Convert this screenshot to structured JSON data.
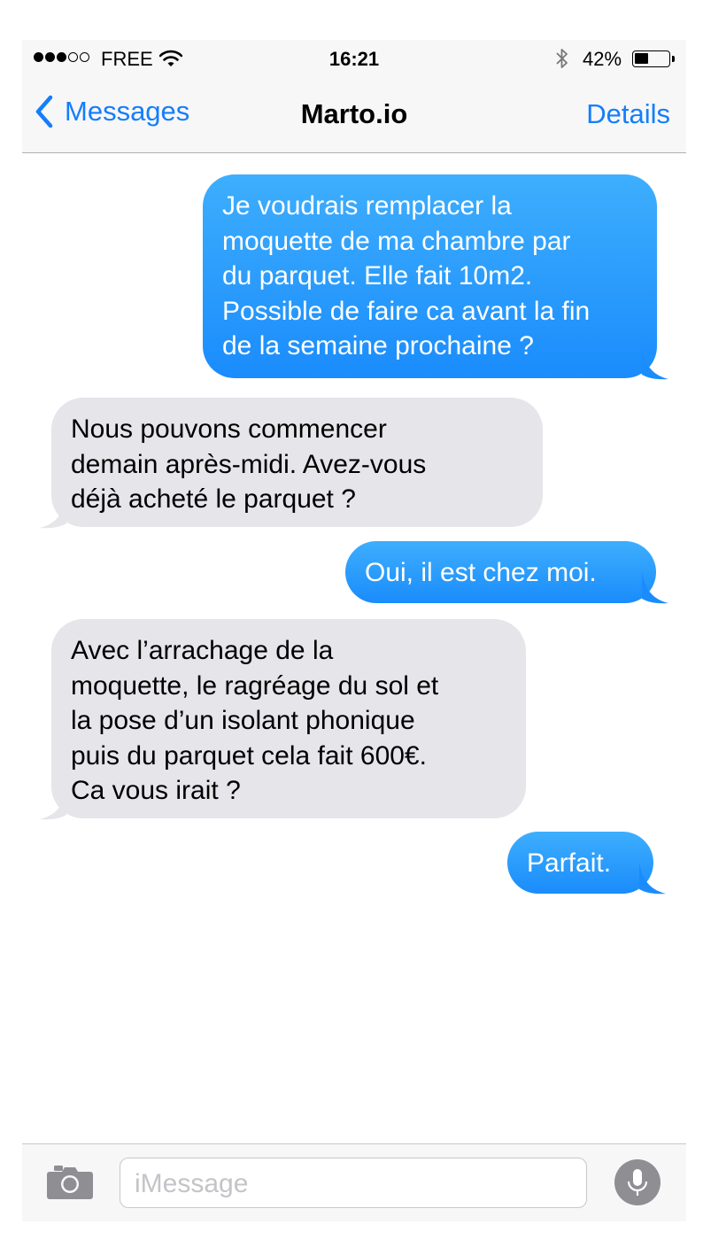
{
  "status_bar": {
    "carrier": "FREE",
    "time": "16:21",
    "battery": "42%",
    "battery_level": 0.42,
    "signal_bars_filled": 3,
    "signal_bars_total": 5
  },
  "nav": {
    "back_label": "Messages",
    "title": "Marto.io",
    "details_label": "Details"
  },
  "messages": [
    {
      "from": "me",
      "text": "Je voudrais remplacer la\nmoquette de ma chambre par\ndu parquet. Elle fait 10m2.\nPossible de faire ca avant la fin\nde la semaine prochaine ?"
    },
    {
      "from": "them",
      "text": "Nous pouvons commencer\ndemain après-midi. Avez-vous\ndéjà acheté le parquet ?"
    },
    {
      "from": "me",
      "text": "Oui, il est chez moi."
    },
    {
      "from": "them",
      "text": "Avec l’arrachage de la\nmoquette, le ragréage du sol et\nla pose d’un isolant phonique\npuis du parquet cela fait 600€.\nCa vous irait ?"
    },
    {
      "from": "me",
      "text": "Parfait."
    }
  ],
  "input": {
    "placeholder": "iMessage"
  },
  "colors": {
    "accent": "#147efb",
    "outgoing_bubble": "#1a8cfc",
    "incoming_bubble": "#e5e5ea"
  }
}
